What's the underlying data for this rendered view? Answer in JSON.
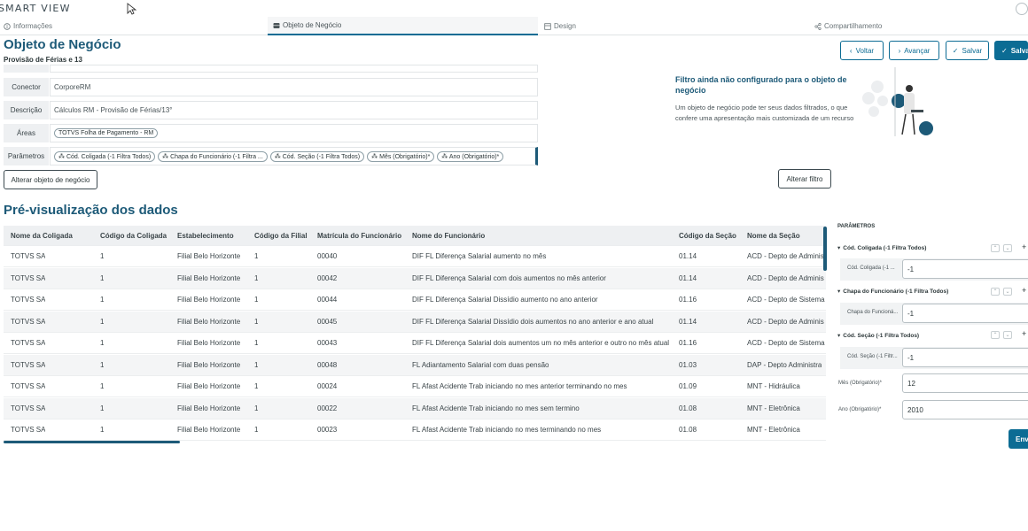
{
  "app": {
    "title": "SMART VIEW"
  },
  "tabs": [
    {
      "label": "Informações",
      "icon": "info-icon"
    },
    {
      "label": "Objeto de Negócio",
      "icon": "database-icon"
    },
    {
      "label": "Design",
      "icon": "design-icon"
    },
    {
      "label": "Compartilhamento",
      "icon": "share-icon"
    }
  ],
  "header": {
    "title": "Objeto de Negócio",
    "subtitle": "Provisão de Férias e 13"
  },
  "actions": {
    "back": "Voltar",
    "next": "Avançar",
    "save": "Salvar",
    "save_primary": "Salva"
  },
  "form": {
    "conector_label": "Conector",
    "conector_value": "CorporeRM",
    "descricao_label": "Descrição",
    "descricao_value": "Cálculos RM - Provisão de Férias/13°",
    "areas_label": "Áreas",
    "areas_chip": "TOTVS Folha de Pagamento - RM",
    "parametros_label": "Parâmetros",
    "parametros_chips": [
      "Cód. Coligada (-1 Filtra Todos)",
      "Chapa do Funcionário (-1 Filtra ...",
      "Cód. Seção (-1 Filtra Todos)",
      "Mês (Obrigatório)*",
      "Ano (Obrigatório)*"
    ],
    "change_object_button": "Alterar objeto de negócio"
  },
  "filter": {
    "title": "Filtro ainda não configurado para o objeto de negócio",
    "description": "Um objeto de negócio pode ter seus dados filtrados, o que confere uma apresentação mais customizada de um recurso",
    "change_filter_button": "Alterar filtro"
  },
  "preview": {
    "title": "Pré-visualização dos dados",
    "columns": [
      "Nome da Coligada",
      "Código da Coligada",
      "Estabelecimento",
      "Código da Filial",
      "Matrícula do Funcionário",
      "Nome do Funcionário",
      "Código da Seção",
      "Nome da Seção"
    ],
    "rows": [
      [
        "TOTVS SA",
        "1",
        "Filial Belo Horizonte",
        "1",
        "00040",
        "DIF FL Diferença Salarial aumento no mês",
        "01.14",
        "ACD - Depto de Adminis"
      ],
      [
        "TOTVS SA",
        "1",
        "Filial Belo Horizonte",
        "1",
        "00042",
        "DIF FL Diferença Salarial com dois aumentos no mês anterior",
        "01.14",
        "ACD - Depto de Adminis"
      ],
      [
        "TOTVS SA",
        "1",
        "Filial Belo Horizonte",
        "1",
        "00044",
        "DIF FL Diferença Salarial Dissídio aumento no ano anterior",
        "01.16",
        "ACD - Depto de Sistema"
      ],
      [
        "TOTVS SA",
        "1",
        "Filial Belo Horizonte",
        "1",
        "00045",
        "DIF FL Diferença Salarial Dissídio dois aumentos no ano anterior e ano atual",
        "01.14",
        "ACD - Depto de Adminis"
      ],
      [
        "TOTVS SA",
        "1",
        "Filial Belo Horizonte",
        "1",
        "00043",
        "DIF FL Diferença Salarial dois aumentos um no mês anterior e outro no mês atual",
        "01.16",
        "ACD - Depto de Sistema"
      ],
      [
        "TOTVS SA",
        "1",
        "Filial Belo Horizonte",
        "1",
        "00048",
        "FL Adiantamento Salarial com duas pensão",
        "01.03",
        "DAP - Depto Administra"
      ],
      [
        "TOTVS SA",
        "1",
        "Filial Belo Horizonte",
        "1",
        "00024",
        "FL Afast Acidente Trab iniciando no mes anterior terminando no mes",
        "01.09",
        "MNT - Hidráulica"
      ],
      [
        "TOTVS SA",
        "1",
        "Filial Belo Horizonte",
        "1",
        "00022",
        "FL Afast Acidente Trab iniciando no mes sem termino",
        "01.08",
        "MNT - Eletrônica"
      ],
      [
        "TOTVS SA",
        "1",
        "Filial Belo Horizonte",
        "1",
        "00023",
        "FL Afast Acidente Trab iniciando no mes terminando no mes",
        "01.08",
        "MNT - Eletrônica"
      ]
    ]
  },
  "params_panel": {
    "title": "PARÂMETROS",
    "groups": [
      {
        "title": "Cód. Coligada (-1 Filtra Todos)",
        "field_label": "Cód. Coligada (-1 ...",
        "value": "-1"
      },
      {
        "title": "Chapa do Funcionário (-1 Filtra Todos)",
        "field_label": "Chapa do Funcioná...",
        "value": "-1"
      },
      {
        "title": "Cód. Seção (-1 Filtra Todos)",
        "field_label": "Cód. Seção (-1 Filtr...",
        "value": "-1"
      }
    ],
    "mes_label": "Mês (Obrigatório)*",
    "mes_value": "12",
    "ano_label": "Ano (Obrigatório)*",
    "ano_value": "2010",
    "send_button": "Env"
  },
  "colors": {
    "primary": "#0c6c94",
    "title": "#1d5a78"
  }
}
